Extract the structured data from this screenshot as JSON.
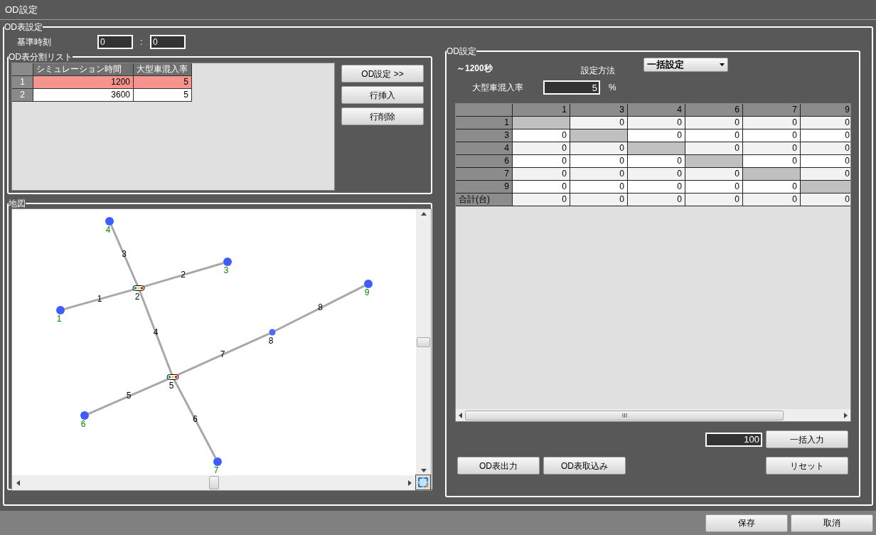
{
  "window": {
    "title": "OD設定"
  },
  "od_table_settings": {
    "legend": "OD表設定",
    "base_time": {
      "label": "基準時刻",
      "hours": "0",
      "separator": ":",
      "minutes": "0"
    },
    "split_list": {
      "legend": "OD表分割リスト",
      "columns": [
        "シミュレーション時間",
        "大型車混入率"
      ],
      "rows": [
        {
          "index": "1",
          "time": "1200",
          "rate": "5",
          "selected": true
        },
        {
          "index": "2",
          "time": "3600",
          "rate": "5",
          "selected": false
        }
      ],
      "buttons": [
        "OD設定 >>",
        "行挿入",
        "行削除"
      ]
    },
    "map": {
      "legend": "地図",
      "nodes": [
        {
          "label": "4",
          "kind": "terminal"
        },
        {
          "label": "3",
          "kind": "terminal"
        },
        {
          "label": "2",
          "kind": "signal"
        },
        {
          "label": "1",
          "kind": "terminal"
        },
        {
          "label": "9",
          "kind": "terminal"
        },
        {
          "label": "8",
          "kind": "junction"
        },
        {
          "label": "5",
          "kind": "signal"
        },
        {
          "label": "6",
          "kind": "terminal"
        },
        {
          "label": "7",
          "kind": "terminal"
        }
      ],
      "links": [
        "1",
        "2",
        "3",
        "4",
        "5",
        "6",
        "7",
        "8"
      ]
    }
  },
  "od_settings": {
    "legend": "OD設定",
    "period": "～1200秒",
    "method": {
      "label": "設定方法",
      "value": "一括設定"
    },
    "heavy_rate": {
      "label": "大型車混入率",
      "value": "5",
      "unit": "%"
    },
    "matrix": {
      "columns": [
        "1",
        "3",
        "4",
        "6",
        "7",
        "9"
      ],
      "rows": [
        {
          "label": "1",
          "cells": [
            null,
            "0",
            "0",
            "0",
            "0",
            "0"
          ]
        },
        {
          "label": "3",
          "cells": [
            "0",
            null,
            "0",
            "0",
            "0",
            "0"
          ]
        },
        {
          "label": "4",
          "cells": [
            "0",
            "0",
            null,
            "0",
            "0",
            "0"
          ]
        },
        {
          "label": "6",
          "cells": [
            "0",
            "0",
            "0",
            null,
            "0",
            "0"
          ]
        },
        {
          "label": "7",
          "cells": [
            "0",
            "0",
            "0",
            "0",
            null,
            "0"
          ]
        },
        {
          "label": "9",
          "cells": [
            "0",
            "0",
            "0",
            "0",
            "0",
            null
          ]
        }
      ],
      "total": {
        "label": "合計(台)",
        "cells": [
          "0",
          "0",
          "0",
          "0",
          "0",
          "0"
        ]
      }
    },
    "bulk_value": "100",
    "buttons": {
      "bulk_input": "一括入力",
      "export": "OD表出力",
      "import": "OD表取込み",
      "reset": "リセット"
    }
  },
  "footer": {
    "buttons": [
      "保存",
      "取消"
    ]
  }
}
